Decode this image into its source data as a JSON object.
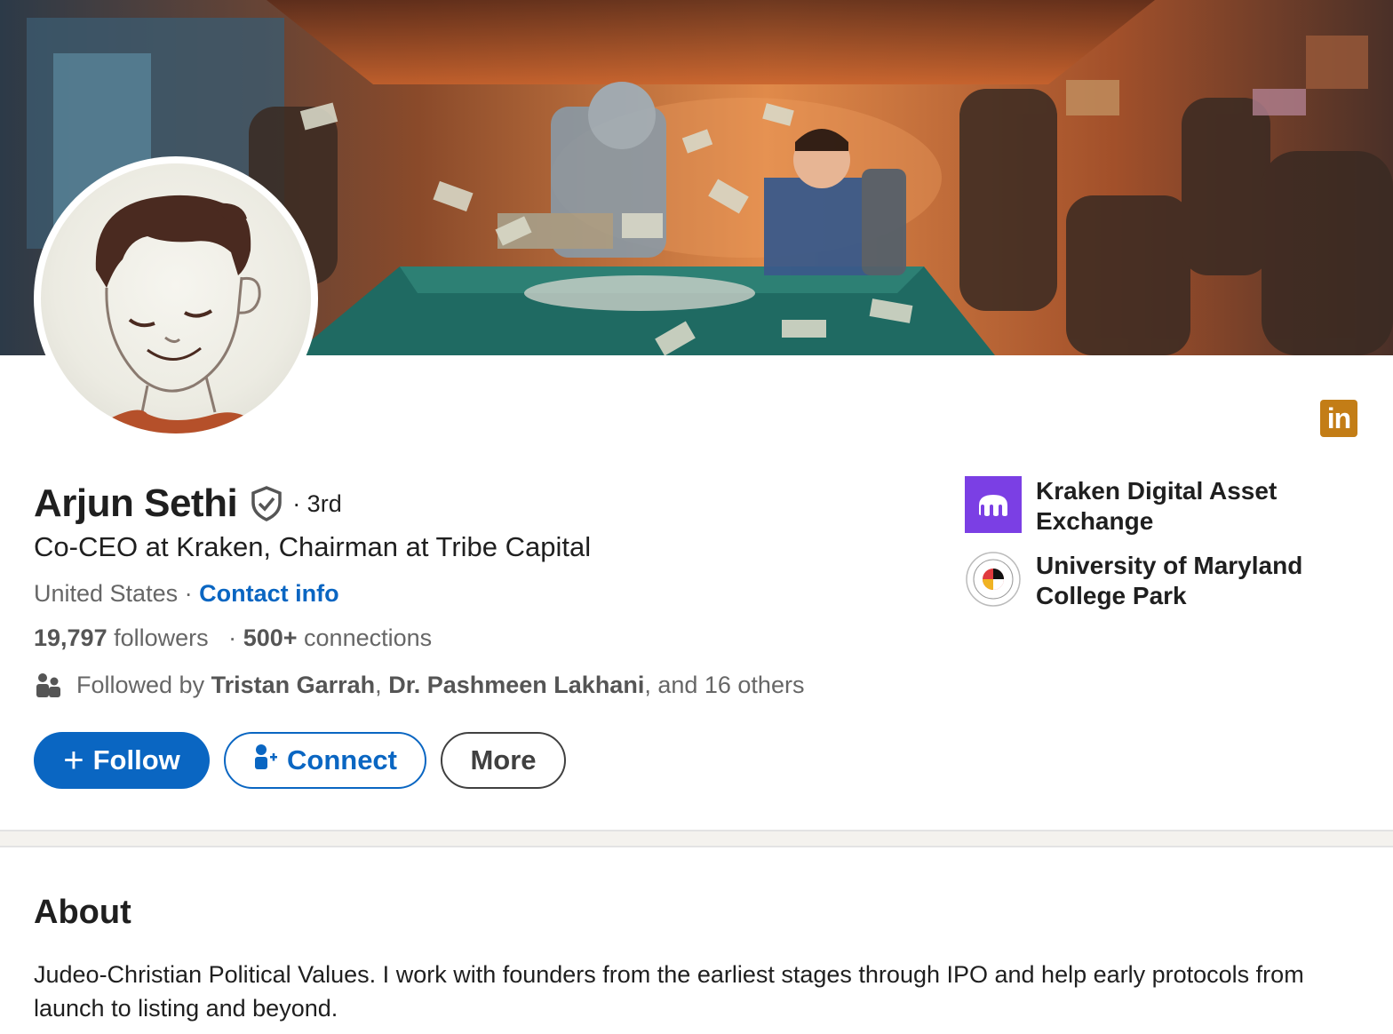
{
  "profile": {
    "name": "Arjun Sethi",
    "degree": "· 3rd",
    "headline": "Co-CEO at Kraken, Chairman at Tribe Capital",
    "location": "United States",
    "location_separator": "·",
    "contact_info": "Contact info",
    "followers_count": "19,797",
    "followers_label": "followers",
    "connections_separator": "·",
    "connections_count": "500+",
    "connections_label": "connections",
    "followed_by_prefix": "Followed by",
    "followed_by_1": "Tristan Garrah",
    "followed_by_comma": ",",
    "followed_by_2": "Dr. Pashmeen Lakhani",
    "followed_by_suffix": ", and 16 others"
  },
  "actions": {
    "follow_icon": "+",
    "follow_label": "Follow",
    "connect_label": "Connect",
    "more_label": "More"
  },
  "badge": {
    "linkedin_text": "in"
  },
  "organizations": [
    {
      "name": "Kraken Digital Asset Exchange",
      "icon": "kraken-logo"
    },
    {
      "name": "University of Maryland College Park",
      "icon": "umd-seal-logo"
    }
  ],
  "about": {
    "title": "About",
    "text": "Judeo-Christian Political Values. I work with founders from the earliest stages through IPO and help early protocols from launch to listing and beyond."
  },
  "colors": {
    "primary_blue": "#0a66c2",
    "kraken_purple": "#7b3fe4",
    "linkedin_badge": "#c37d16",
    "text_dark": "#1f1f1f",
    "text_muted": "#666666"
  }
}
